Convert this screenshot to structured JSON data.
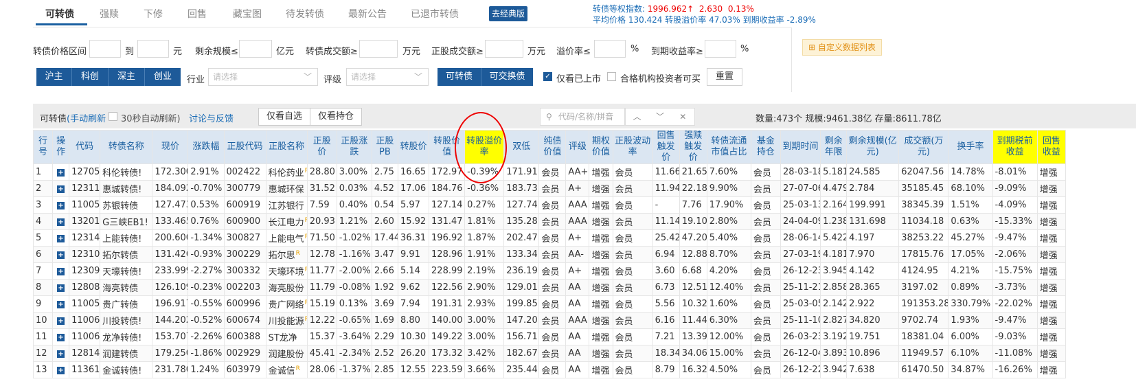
{
  "nav": {
    "tabs": [
      "可转债",
      "强赎",
      "下修",
      "回售",
      "藏宝图",
      "待发转债",
      "最新公告",
      "已退市转债"
    ],
    "classic_btn": "去经典版"
  },
  "index_info": {
    "line1_label": "转债等权指数:",
    "line1_value": "1996.962↑",
    "line1_change": "2.630",
    "line1_pct": "0.13%",
    "line2": "平均价格 130.424   转股溢价率 47.03%   到期收益率 -2.89%"
  },
  "filters": {
    "price_range": "转债价格区间",
    "to": "到",
    "yuan": "元",
    "remain_scale": "剩余规模≤",
    "yi_yuan": "亿元",
    "turnover": "转债成交额≥",
    "wan_yuan": "万元",
    "stock_turnover": "正股成交额≥",
    "wan_yuan2": "万元",
    "premium": "溢价率≤",
    "pct": "%",
    "ytm": "到期收益率≥",
    "pct2": "%",
    "custom_list": "⊞ 自定义数据列表",
    "markets": [
      "沪主",
      "科创",
      "深主",
      "创业"
    ],
    "industry": "行业",
    "industry_ph": "请选择",
    "rating": "评级",
    "rating_ph": "请选择",
    "types": [
      "可转债",
      "可交换债"
    ],
    "only_listed": "仅看已上市",
    "qualified_only": "合格机构投资者可买",
    "reset": "重置"
  },
  "toolbar": {
    "title": "可转债",
    "manual_refresh": "(手动刷新",
    "auto_refresh": "30秒自动刷新)",
    "discuss": "讨论与反馈",
    "views": [
      "仅看自选",
      "仅看持仓"
    ],
    "search_ph": "代码/名称/拼音",
    "stats": "数量:473个   规模:9461.38亿   存量:8611.78亿"
  },
  "table": {
    "headers": [
      "行号",
      "操作",
      "代码",
      "转债名称",
      "现价",
      "涨跌幅",
      "正股代码",
      "正股名称",
      "正股价",
      "正股涨跌",
      "正股PB",
      "转股价",
      "转股价值",
      "转股溢价率",
      "双低",
      "纯债价值",
      "评级",
      "期权价值",
      "正股波动率",
      "回售触发价",
      "强赎触发价",
      "转债流通市值占比",
      "基金持仓",
      "到期时间",
      "剩余年限",
      "剩余规模(亿元)",
      "成交额(万元)",
      "换手率",
      "到期税前收益",
      "回售收益"
    ],
    "rows": [
      [
        "1",
        "127058",
        "科伦转债!",
        "172.300",
        "2.91%",
        "002422",
        "科伦药业",
        "28.80",
        "3.00%",
        "2.75",
        "16.65",
        "172.97",
        "-0.39%",
        "171.91",
        "会员",
        "AA+",
        "增强",
        "会员",
        "11.66",
        "21.65",
        "7.60%",
        "会员",
        "28-03-18",
        "5.181",
        "24.585",
        "62047.56",
        "14.78%",
        "-8.01%",
        "增强"
      ],
      [
        "2",
        "123118",
        "惠城转债!",
        "184.092",
        "-0.70%",
        "300779",
        "惠城环保",
        "31.52",
        "0.03%",
        "4.52",
        "17.06",
        "184.76",
        "-0.36%",
        "183.73",
        "会员",
        "A+",
        "增强",
        "会员",
        "11.94",
        "22.18",
        "9.90%",
        "会员",
        "27-07-06",
        "4.479",
        "2.784",
        "35185.45",
        "68.10%",
        "-9.09%",
        "增强"
      ],
      [
        "3",
        "110053",
        "苏银转债",
        "127.473",
        "0.53%",
        "600919",
        "江苏银行",
        "7.59",
        "0.40%",
        "0.54",
        "5.97",
        "127.14",
        "0.27%",
        "127.74",
        "会员",
        "AAA",
        "增强",
        "会员",
        "-",
        "7.76",
        "17.90%",
        "会员",
        "25-03-13",
        "2.164",
        "199.991",
        "38345.39",
        "1.51%",
        "-4.09%",
        "增强"
      ],
      [
        "4",
        "132018",
        "G三峡EB1!",
        "133.465",
        "0.76%",
        "600900",
        "长江电力",
        "20.93",
        "1.21%",
        "2.60",
        "15.92",
        "131.47",
        "1.81%",
        "135.28",
        "会员",
        "AAA",
        "增强",
        "会员",
        "11.14",
        "19.10",
        "2.80%",
        "会员",
        "24-04-09",
        "1.238",
        "131.698",
        "11034.18",
        "0.63%",
        "-15.33%",
        "增强"
      ],
      [
        "5",
        "123148",
        "上能转债!",
        "200.600",
        "-1.34%",
        "300827",
        "上能电气",
        "71.50",
        "-1.02%",
        "17.44",
        "36.31",
        "196.92",
        "1.87%",
        "202.47",
        "会员",
        "A+",
        "增强",
        "会员",
        "25.42",
        "47.20",
        "5.40%",
        "会员",
        "28-06-14",
        "5.422",
        "4.197",
        "38253.22",
        "45.27%",
        "-9.47%",
        "增强"
      ],
      [
        "6",
        "123105",
        "拓尔转债",
        "131.426",
        "-0.93%",
        "300229",
        "拓尔思",
        "12.78",
        "-1.16%",
        "3.47",
        "9.91",
        "128.96",
        "1.91%",
        "133.34",
        "会员",
        "AA-",
        "增强",
        "会员",
        "6.94",
        "12.88",
        "8.70%",
        "会员",
        "27-03-19",
        "4.181",
        "7.970",
        "17815.76",
        "17.05%",
        "-2.06%",
        "增强"
      ],
      [
        "7",
        "123092",
        "天壕转债!",
        "233.999",
        "-2.27%",
        "300332",
        "天壕环境",
        "11.77",
        "-2.00%",
        "2.66",
        "5.14",
        "228.99",
        "2.19%",
        "236.19",
        "会员",
        "A+",
        "增强",
        "会员",
        "3.60",
        "6.68",
        "4.20%",
        "会员",
        "26-12-23",
        "3.945",
        "4.142",
        "4124.95",
        "4.21%",
        "-15.75%",
        "增强"
      ],
      [
        "8",
        "128081",
        "海亮转债",
        "126.109",
        "-0.23%",
        "002203",
        "海亮股份",
        "11.79",
        "-0.08%",
        "1.92",
        "9.62",
        "122.56",
        "2.90%",
        "129.01",
        "会员",
        "AA",
        "增强",
        "会员",
        "6.73",
        "12.51",
        "12.40%",
        "会员",
        "25-11-21",
        "2.858",
        "28.365",
        "3197.02",
        "0.89%",
        "-3.73%",
        "增强"
      ],
      [
        "9",
        "110052",
        "贵广转债",
        "196.917",
        "-0.55%",
        "600996",
        "贵广网络",
        "15.19",
        "0.13%",
        "3.69",
        "7.94",
        "191.31",
        "2.93%",
        "199.85",
        "会员",
        "AA",
        "增强",
        "会员",
        "5.56",
        "10.32",
        "1.60%",
        "会员",
        "25-03-05",
        "2.142",
        "2.922",
        "191353.28",
        "330.79%",
        "-22.02%",
        "增强"
      ],
      [
        "10",
        "110061",
        "川投转债!",
        "144.202",
        "-0.52%",
        "600674",
        "川投能源",
        "12.22",
        "-0.65%",
        "1.69",
        "8.80",
        "140.00",
        "3.00%",
        "147.20",
        "会员",
        "AAA",
        "增强",
        "会员",
        "6.16",
        "11.44",
        "6.30%",
        "会员",
        "25-11-10",
        "2.827",
        "34.820",
        "9702.74",
        "1.93%",
        "-9.47%",
        "增强"
      ],
      [
        "11",
        "110068",
        "龙净转债!",
        "153.707",
        "-2.26%",
        "600388",
        "ST龙净",
        "15.37",
        "-3.64%",
        "2.29",
        "10.30",
        "149.22",
        "3.00%",
        "156.71",
        "会员",
        "AA",
        "增强",
        "会员",
        "7.21",
        "13.39",
        "12.00%",
        "会员",
        "26-03-23",
        "3.192",
        "19.751",
        "18381.04",
        "6.00%",
        "-9.03%",
        "增强"
      ],
      [
        "12",
        "128140",
        "润建转债",
        "179.250",
        "-1.86%",
        "002929",
        "润建股份",
        "45.41",
        "-2.34%",
        "2.52",
        "26.20",
        "173.32",
        "3.42%",
        "182.67",
        "会员",
        "AA",
        "增强",
        "会员",
        "18.34",
        "34.06",
        "15.00%",
        "会员",
        "26-12-04",
        "3.893",
        "10.896",
        "11949.57",
        "6.10%",
        "-11.08%",
        "增强"
      ],
      [
        "13",
        "113615",
        "金诚转债!",
        "231.780",
        "1.24%",
        "603979",
        "金诚信",
        "28.06",
        "-1.37%",
        "2.85",
        "12.55",
        "223.59",
        "3.66%",
        "235.44",
        "会员",
        "AA",
        "增强",
        "会员",
        "8.79",
        "16.32",
        "4.50%",
        "会员",
        "26-12-22",
        "3.942",
        "7.638",
        "61470.50",
        "34.87%",
        "-16.26%",
        "增强"
      ]
    ],
    "r_marks": [
      "1",
      "4",
      "5",
      "6",
      "7",
      "9",
      "10",
      "13"
    ]
  },
  "colors": {
    "brand": "#1d5a99",
    "up": "#e00000",
    "down": "#009900",
    "highlight": "#ffff00"
  }
}
